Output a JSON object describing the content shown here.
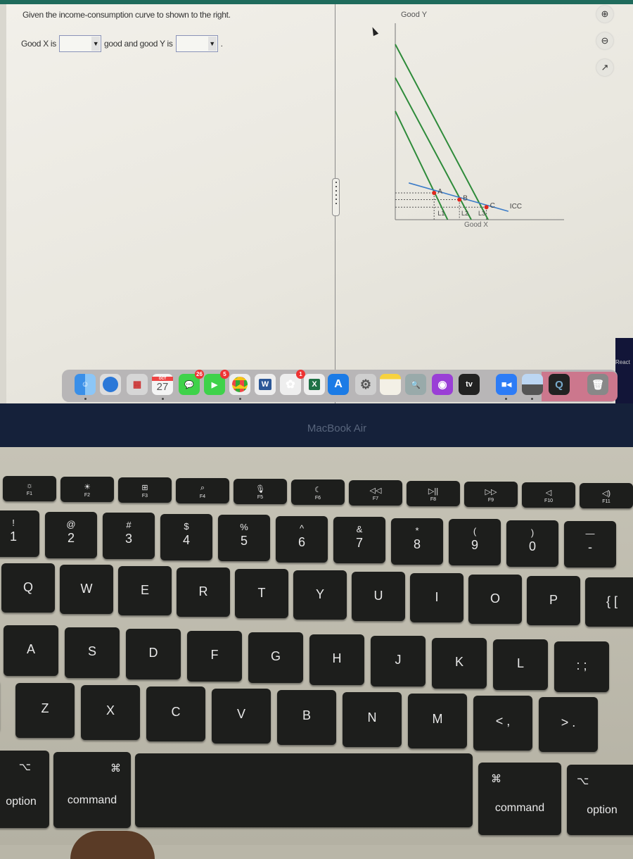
{
  "question": {
    "prompt": "Given the income-consumption curve to shown to the right.",
    "good_x_label": "Good X is",
    "good_x_value": "",
    "middle_text": "good and good Y is",
    "good_y_value": "",
    "end_text": ".",
    "dropdown_arrow": "▼"
  },
  "graph_tools": {
    "zoom_in": "⊕",
    "zoom_out": "⊖",
    "popout": "↗"
  },
  "chart_data": {
    "type": "line",
    "title": "",
    "xlabel": "Good X",
    "ylabel": "Good Y",
    "grid": false,
    "xlim": [
      0,
      10
    ],
    "ylim": [
      0,
      10
    ],
    "series": [
      {
        "name": "L1",
        "kind": "budget-line",
        "color": "#2e8b3a",
        "points": [
          [
            0,
            6.5
          ],
          [
            3.1,
            0
          ]
        ]
      },
      {
        "name": "L2",
        "kind": "budget-line",
        "color": "#2e8b3a",
        "points": [
          [
            0,
            8.5
          ],
          [
            4.5,
            0
          ]
        ]
      },
      {
        "name": "L3",
        "kind": "budget-line",
        "color": "#2e8b3a",
        "points": [
          [
            0,
            10.5
          ],
          [
            5.5,
            0
          ]
        ]
      },
      {
        "name": "ICC",
        "kind": "income-consumption-curve",
        "color": "#3a7bc8",
        "points": [
          [
            0.8,
            2.2
          ],
          [
            6.7,
            0.5
          ]
        ]
      }
    ],
    "points": [
      {
        "label": "A",
        "x": 2.3,
        "y": 1.6,
        "color": "#e0281e"
      },
      {
        "label": "B",
        "x": 3.8,
        "y": 1.2,
        "color": "#e0281e"
      },
      {
        "label": "C",
        "x": 5.4,
        "y": 0.75,
        "color": "#e0281e"
      }
    ],
    "line_labels": [
      "L1",
      "L2",
      "L3",
      "ICC"
    ]
  },
  "dock": {
    "calendar_month": "OCT",
    "calendar_day": "27",
    "messages_badge": "26",
    "facetime_badge": "5",
    "photos_badge": "1",
    "word": "W",
    "excel": "X",
    "tv": "tv",
    "apps": [
      "Finder",
      "Safari",
      "Launchpad",
      "Calendar",
      "Messages",
      "FaceTime",
      "Chrome",
      "Word",
      "Photos",
      "Excel",
      "App Store",
      "System Preferences",
      "Notes",
      "Preview",
      "Podcasts",
      "Apple TV",
      "Zoom",
      "Preview Image",
      "QuickTime",
      "Trash"
    ]
  },
  "sidebar_cut": "React",
  "laptop_label": "MacBook Air",
  "keyboard": {
    "fkeys": [
      {
        "sym": "☼",
        "lab": "F1"
      },
      {
        "sym": "☀",
        "lab": "F2"
      },
      {
        "sym": "⊞",
        "lab": "F3"
      },
      {
        "sym": "⌕",
        "lab": "F4"
      },
      {
        "sym": "🎙",
        "lab": "F5"
      },
      {
        "sym": "☾",
        "lab": "F6"
      },
      {
        "sym": "◁◁",
        "lab": "F7"
      },
      {
        "sym": "▷||",
        "lab": "F8"
      },
      {
        "sym": "▷▷",
        "lab": "F9"
      },
      {
        "sym": "◁",
        "lab": "F10"
      },
      {
        "sym": "◁)",
        "lab": "F11"
      }
    ],
    "numbers": [
      {
        "top": "!",
        "main": "1"
      },
      {
        "top": "@",
        "main": "2"
      },
      {
        "top": "#",
        "main": "3"
      },
      {
        "top": "$",
        "main": "4"
      },
      {
        "top": "%",
        "main": "5"
      },
      {
        "top": "^",
        "main": "6"
      },
      {
        "top": "&",
        "main": "7"
      },
      {
        "top": "*",
        "main": "8"
      },
      {
        "top": "(",
        "main": "9"
      },
      {
        "top": ")",
        "main": "0"
      },
      {
        "top": "—",
        "main": "-"
      }
    ],
    "row_q": [
      "Q",
      "W",
      "E",
      "R",
      "T",
      "Y",
      "U",
      "I",
      "O",
      "P",
      "{ ["
    ],
    "row_a": [
      "A",
      "S",
      "D",
      "F",
      "G",
      "H",
      "J",
      "K",
      "L",
      ": ;"
    ],
    "row_z": [
      "Z",
      "X",
      "C",
      "V",
      "B",
      "N",
      "M",
      "< ,",
      "> ."
    ],
    "left_option": {
      "sym": "⌥",
      "lab": "option"
    },
    "left_command": {
      "sym": "⌘",
      "lab": "command"
    },
    "right_command": {
      "sym": "⌘",
      "lab": "command"
    },
    "right_option": {
      "sym": "⌥",
      "lab": "option"
    }
  }
}
